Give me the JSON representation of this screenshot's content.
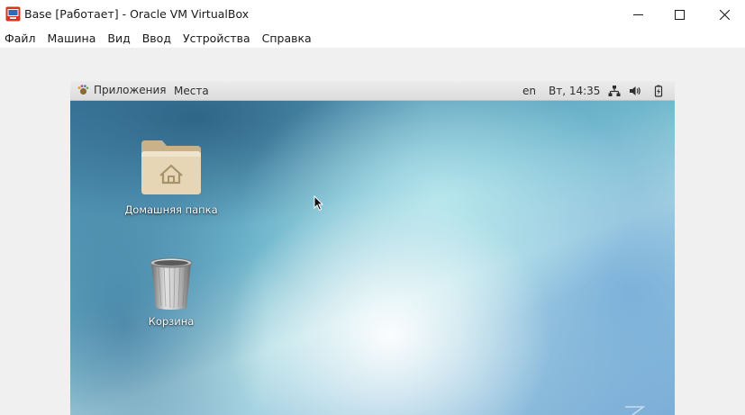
{
  "window": {
    "title": "Base [Работает] - Oracle VM VirtualBox",
    "icon": "virtualbox-app-icon",
    "controls": {
      "minimize": "minimize-icon",
      "maximize": "maximize-icon",
      "close": "close-icon"
    }
  },
  "menubar": {
    "items": [
      "Файл",
      "Машина",
      "Вид",
      "Ввод",
      "Устройства",
      "Справка"
    ]
  },
  "guest": {
    "panel": {
      "apps_label": "Приложения",
      "places_label": "Места",
      "keyboard_layout": "en",
      "clock": "Вт, 14:35",
      "tray_icons": [
        "network-icon",
        "volume-icon",
        "battery-icon"
      ]
    },
    "desktop": {
      "icons": [
        {
          "label": "Домашняя папка",
          "icon": "home-folder-icon"
        },
        {
          "label": "Корзина",
          "icon": "trash-icon"
        }
      ]
    }
  },
  "colors": {
    "titlebar_bg": "#ffffff",
    "vm_frame_bg": "#f0f0f0",
    "panel_bg": "#e4e4e4",
    "desktop_accent": "#6fb6cc"
  }
}
